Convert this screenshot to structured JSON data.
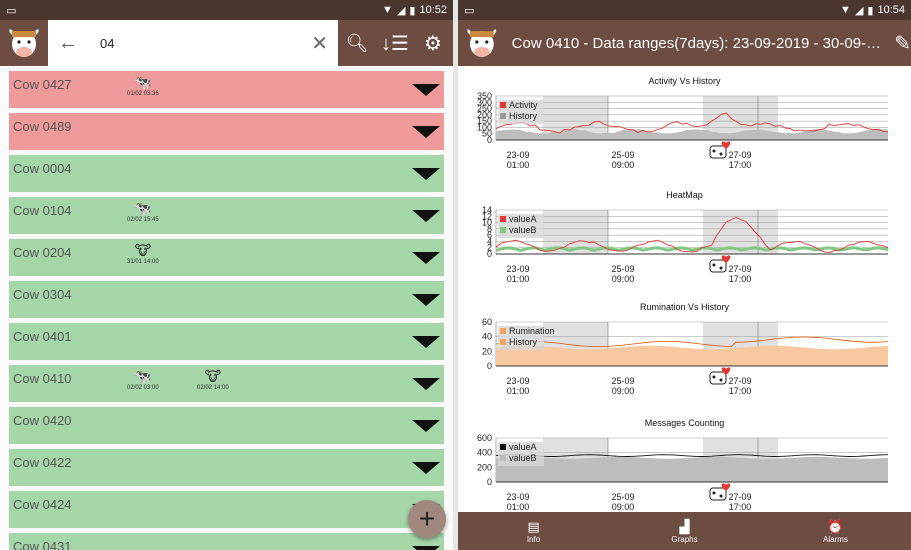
{
  "left": {
    "status": {
      "time": "10:52"
    },
    "search": {
      "value": "04"
    },
    "rows": [
      {
        "name": "Cow 0427",
        "color": "red",
        "badges": [
          {
            "icon": "cow-alert-icon",
            "glyph": "🐄",
            "ts": "01/02 03:36"
          }
        ]
      },
      {
        "name": "Cow 0489",
        "color": "red",
        "badges": []
      },
      {
        "name": "Cow 0004",
        "color": "green",
        "badges": []
      },
      {
        "name": "Cow 0104",
        "color": "green",
        "badges": [
          {
            "icon": "cow-alert-icon",
            "glyph": "🐄",
            "ts": "02/02 15:45"
          }
        ]
      },
      {
        "name": "Cow 0204",
        "color": "green",
        "badges": [
          {
            "icon": "cow-face-icon",
            "glyph": "🐮",
            "ts": "31/01 14:00"
          }
        ]
      },
      {
        "name": "Cow 0304",
        "color": "green",
        "badges": []
      },
      {
        "name": "Cow 0401",
        "color": "green",
        "badges": []
      },
      {
        "name": "Cow 0410",
        "color": "green",
        "badges": [
          {
            "icon": "cow-heat-icon",
            "glyph": "🐄",
            "ts": "02/02 03:00"
          },
          {
            "icon": "cow-face-icon",
            "glyph": "🐮",
            "ts": "02/02 14:00"
          }
        ]
      },
      {
        "name": "Cow 0420",
        "color": "green",
        "badges": []
      },
      {
        "name": "Cow 0422",
        "color": "green",
        "badges": []
      },
      {
        "name": "Cow 0424",
        "color": "green",
        "badges": []
      },
      {
        "name": "Cow 0431",
        "color": "green",
        "badges": []
      }
    ],
    "fab_label": "+"
  },
  "right": {
    "status": {
      "time": "10:54"
    },
    "title": "Cow 0410 - Data ranges(7days): 23-09-2019 - 30-09-20...",
    "nav": [
      {
        "label": "Info",
        "icon": "info-icon",
        "glyph": "▤"
      },
      {
        "label": "Graphs",
        "icon": "graphs-icon",
        "glyph": "▟"
      },
      {
        "label": "Alarms",
        "icon": "alarm-icon",
        "glyph": "⏰"
      }
    ]
  },
  "chart_data": [
    {
      "type": "line",
      "title": "Activity Vs History",
      "x_ticks": [
        "23-09\n01:00",
        "25-09\n09:00",
        "27-09\n17:00"
      ],
      "y_ticks": [
        "350",
        "300",
        "250",
        "200",
        "150",
        "100",
        "50",
        "0"
      ],
      "ylim": [
        0,
        350
      ],
      "series": [
        {
          "name": "Activity",
          "color": "#e53935"
        },
        {
          "name": "History",
          "color": "#999999"
        }
      ]
    },
    {
      "type": "line",
      "title": "HeatMap",
      "x_ticks": [
        "23-09\n01:00",
        "25-09\n09:00",
        "27-09\n17:00"
      ],
      "y_ticks": [
        "14",
        "12",
        "10",
        "8",
        "6",
        "4",
        "2",
        "0"
      ],
      "ylim": [
        0,
        14
      ],
      "series": [
        {
          "name": "valueA",
          "color": "#e53935"
        },
        {
          "name": "valueB",
          "color": "#81c784"
        }
      ]
    },
    {
      "type": "area",
      "title": "Rumination Vs History",
      "x_ticks": [
        "23-09\n01:00",
        "25-09\n09:00",
        "27-09\n17:00"
      ],
      "y_ticks": [
        "60",
        "40",
        "20",
        "0"
      ],
      "ylim": [
        0,
        60
      ],
      "series": [
        {
          "name": "Rumination",
          "color": "#f4a460"
        },
        {
          "name": "History",
          "color": "#f4a460"
        }
      ]
    },
    {
      "type": "area",
      "title": "Messages Counting",
      "x_ticks": [
        "23-09\n01:00",
        "25-09\n09:00",
        "27-09\n17:00"
      ],
      "y_ticks": [
        "600",
        "400",
        "200",
        "0"
      ],
      "ylim": [
        0,
        600
      ],
      "series": [
        {
          "name": "valueA",
          "color": "#111111"
        },
        {
          "name": "valueB",
          "color": "#bbbbbb"
        }
      ]
    }
  ]
}
